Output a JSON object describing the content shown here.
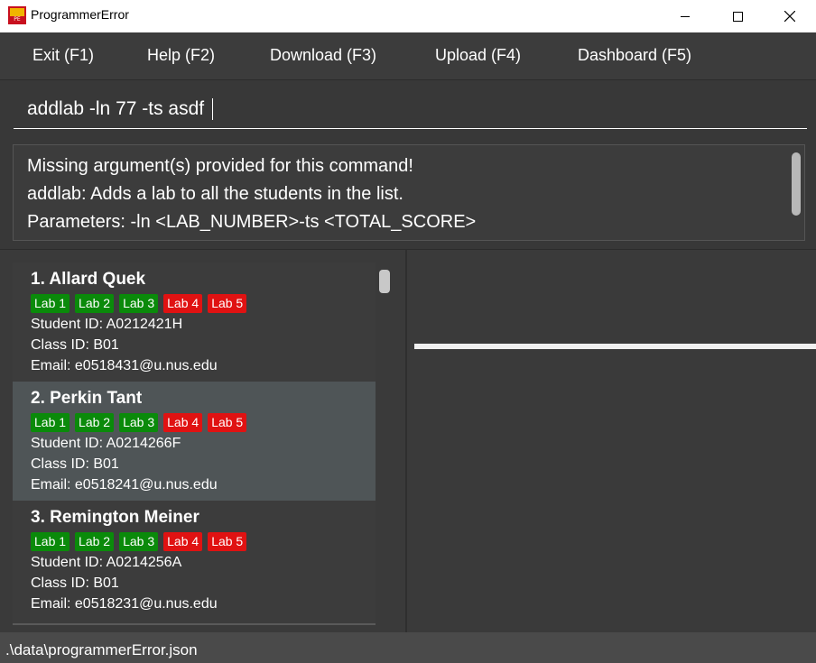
{
  "window": {
    "title": "ProgrammerError",
    "icon": "app-logo-icon",
    "icon_text": "PE"
  },
  "menu": [
    {
      "label": "Exit (F1)"
    },
    {
      "label": "Help (F2)"
    },
    {
      "label": "Download (F3)"
    },
    {
      "label": "Upload (F4)"
    },
    {
      "label": "Dashboard (F5)"
    }
  ],
  "command": {
    "value": "addlab -ln 77 -ts asdf"
  },
  "result": {
    "lines": [
      "Missing argument(s) provided for this command!",
      "addlab: Adds a lab to all the students in the list.",
      "Parameters: -ln <LAB_NUMBER>-ts <TOTAL_SCORE>"
    ]
  },
  "students": [
    {
      "name": "1.  Allard Quek",
      "labs": [
        {
          "label": "Lab 1",
          "status": "done"
        },
        {
          "label": "Lab 2",
          "status": "done"
        },
        {
          "label": "Lab 3",
          "status": "done"
        },
        {
          "label": "Lab 4",
          "status": "todo"
        },
        {
          "label": "Lab 5",
          "status": "todo"
        }
      ],
      "student_id": "Student ID: A0212421H",
      "class_id": "Class ID: B01",
      "email": "Email: e0518431@u.nus.edu",
      "selected": false
    },
    {
      "name": "2.  Perkin Tant",
      "labs": [
        {
          "label": "Lab 1",
          "status": "done"
        },
        {
          "label": "Lab 2",
          "status": "done"
        },
        {
          "label": "Lab 3",
          "status": "done"
        },
        {
          "label": "Lab 4",
          "status": "todo"
        },
        {
          "label": "Lab 5",
          "status": "todo"
        }
      ],
      "student_id": "Student ID: A0214266F",
      "class_id": "Class ID: B01",
      "email": "Email: e0518241@u.nus.edu",
      "selected": true
    },
    {
      "name": "3.  Remington Meiner",
      "labs": [
        {
          "label": "Lab 1",
          "status": "done"
        },
        {
          "label": "Lab 2",
          "status": "done"
        },
        {
          "label": "Lab 3",
          "status": "done"
        },
        {
          "label": "Lab 4",
          "status": "todo"
        },
        {
          "label": "Lab 5",
          "status": "todo"
        }
      ],
      "student_id": "Student ID: A0214256A",
      "class_id": "Class ID: B01",
      "email": "Email: e0518231@u.nus.edu",
      "selected": false
    }
  ],
  "status_bar": {
    "path": ".\\data\\programmerError.json"
  },
  "colors": {
    "lab_done": "#0a8a0a",
    "lab_todo": "#e01212",
    "selected_card": "#4f5557",
    "background": "#3a3a3a"
  }
}
